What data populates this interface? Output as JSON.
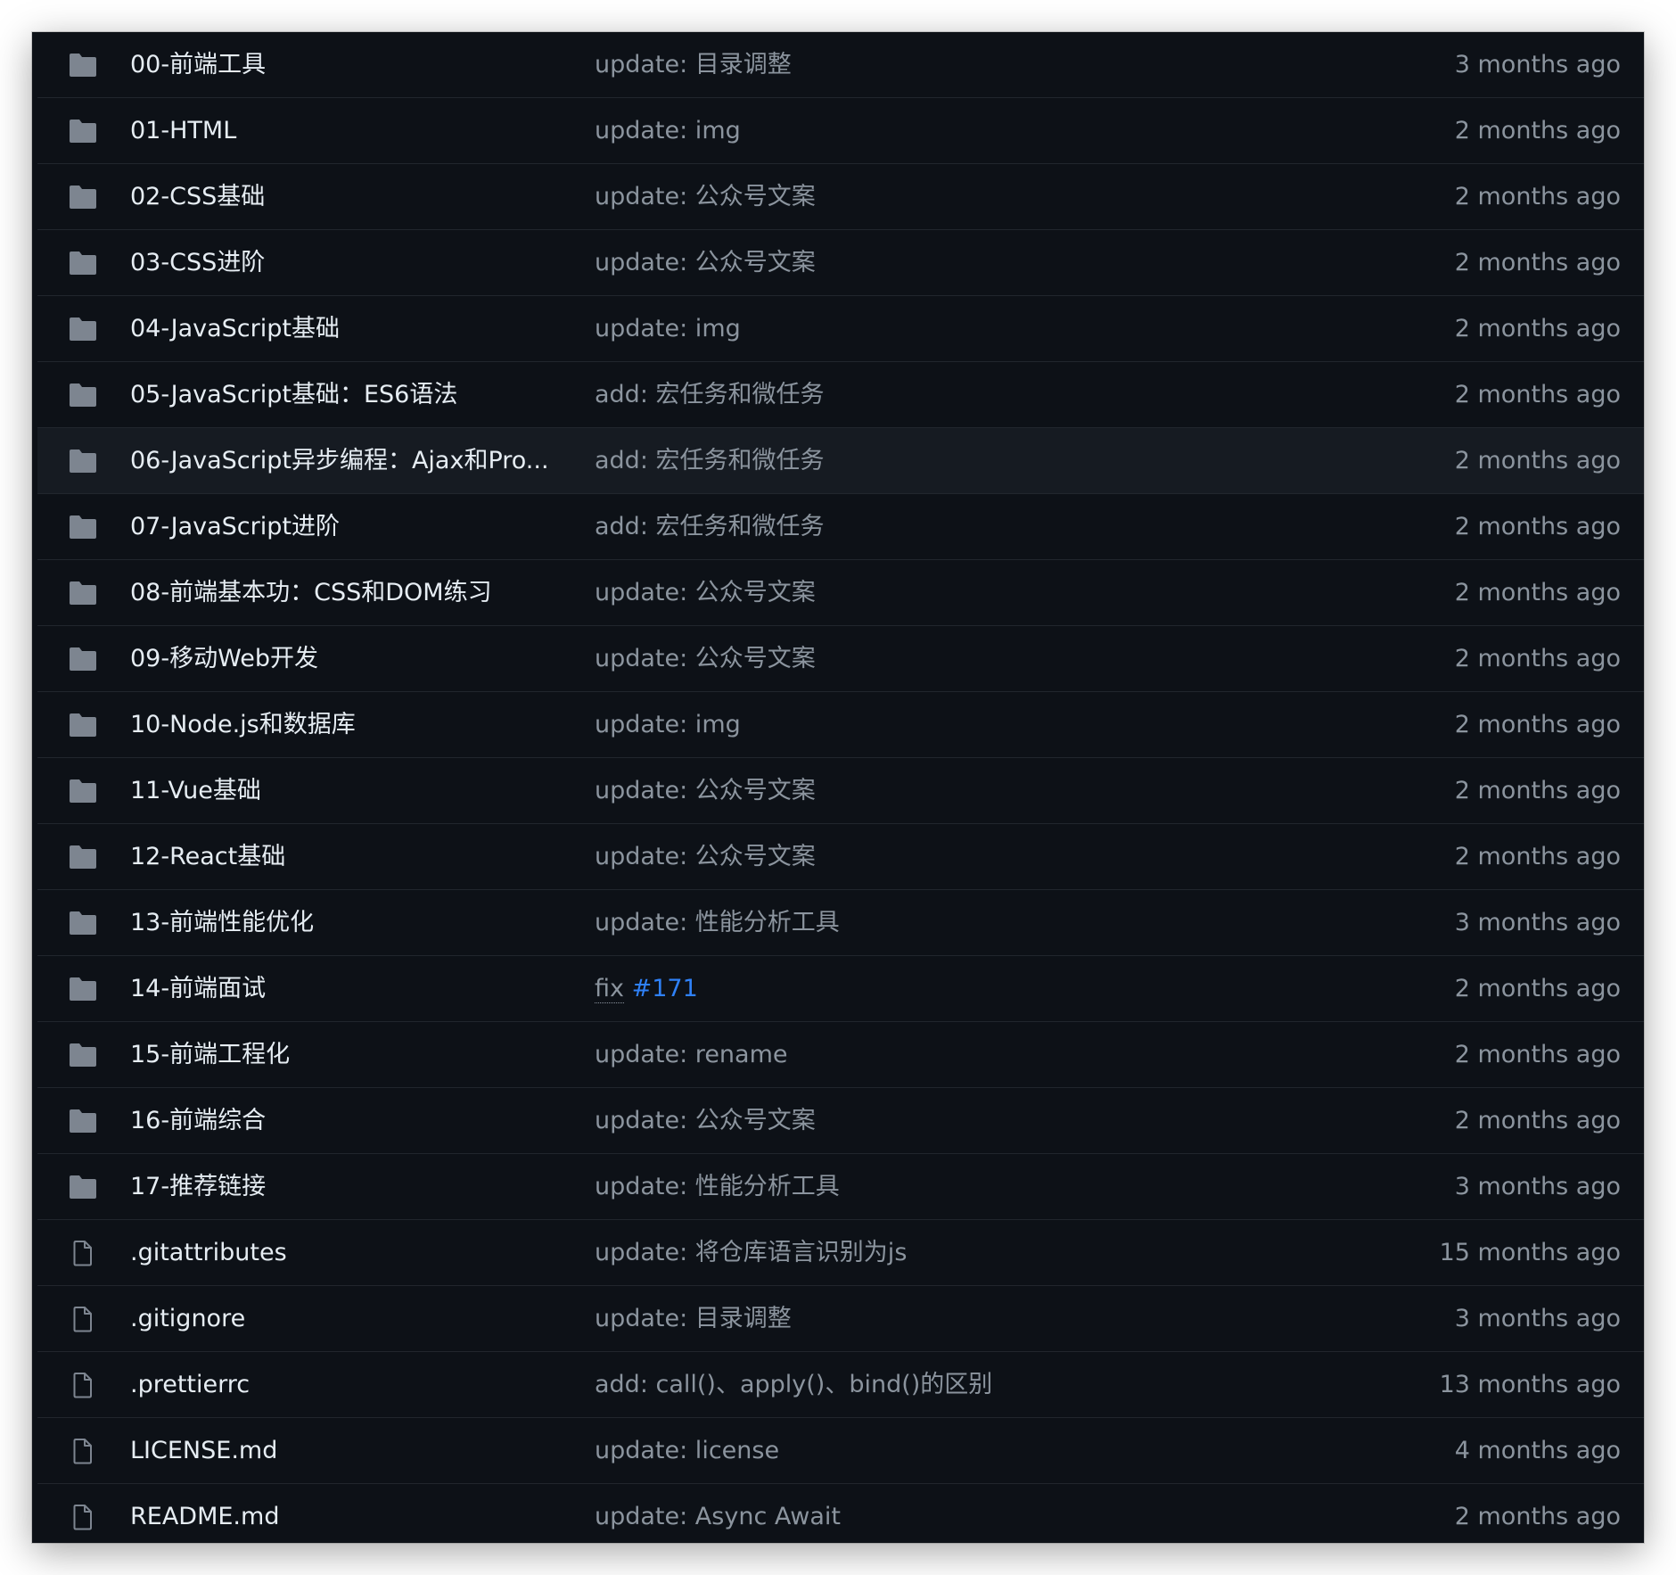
{
  "colors": {
    "background": "#0d1117",
    "row_border": "#21262d",
    "hover_row": "#161b22",
    "folder_icon": "#7d8590",
    "file_icon": "#7d8590",
    "name_text": "#e6edf3",
    "muted_text": "#8b949e",
    "link": "#2f81f7"
  },
  "rows": [
    {
      "type": "folder",
      "icon": "folder-icon",
      "name": "00-前端工具",
      "message": "update: 目录调整",
      "age": "3 months ago"
    },
    {
      "type": "folder",
      "icon": "folder-icon",
      "name": "01-HTML",
      "message": "update: img",
      "age": "2 months ago"
    },
    {
      "type": "folder",
      "icon": "folder-icon",
      "name": "02-CSS基础",
      "message": "update: 公众号文案",
      "age": "2 months ago"
    },
    {
      "type": "folder",
      "icon": "folder-icon",
      "name": "03-CSS进阶",
      "message": "update: 公众号文案",
      "age": "2 months ago"
    },
    {
      "type": "folder",
      "icon": "folder-icon",
      "name": "04-JavaScript基础",
      "message": "update: img",
      "age": "2 months ago"
    },
    {
      "type": "folder",
      "icon": "folder-icon",
      "name": "05-JavaScript基础：ES6语法",
      "message": "add: 宏任务和微任务",
      "age": "2 months ago"
    },
    {
      "type": "folder",
      "icon": "folder-icon",
      "name": "06-JavaScript异步编程：Ajax和Pro...",
      "message": "add: 宏任务和微任务",
      "age": "2 months ago",
      "hovered": true
    },
    {
      "type": "folder",
      "icon": "folder-icon",
      "name": "07-JavaScript进阶",
      "message": "add: 宏任务和微任务",
      "age": "2 months ago"
    },
    {
      "type": "folder",
      "icon": "folder-icon",
      "name": "08-前端基本功：CSS和DOM练习",
      "message": "update: 公众号文案",
      "age": "2 months ago"
    },
    {
      "type": "folder",
      "icon": "folder-icon",
      "name": "09-移动Web开发",
      "message": "update: 公众号文案",
      "age": "2 months ago"
    },
    {
      "type": "folder",
      "icon": "folder-icon",
      "name": "10-Node.js和数据库",
      "message": "update: img",
      "age": "2 months ago"
    },
    {
      "type": "folder",
      "icon": "folder-icon",
      "name": "11-Vue基础",
      "message": "update: 公众号文案",
      "age": "2 months ago"
    },
    {
      "type": "folder",
      "icon": "folder-icon",
      "name": "12-React基础",
      "message": "update: 公众号文案",
      "age": "2 months ago"
    },
    {
      "type": "folder",
      "icon": "folder-icon",
      "name": "13-前端性能优化",
      "message": "update: 性能分析工具",
      "age": "3 months ago"
    },
    {
      "type": "folder",
      "icon": "folder-icon",
      "name": "14-前端面试",
      "message": "fix",
      "message_link": "#171",
      "age": "2 months ago"
    },
    {
      "type": "folder",
      "icon": "folder-icon",
      "name": "15-前端工程化",
      "message": "update: rename",
      "age": "2 months ago"
    },
    {
      "type": "folder",
      "icon": "folder-icon",
      "name": "16-前端综合",
      "message": "update: 公众号文案",
      "age": "2 months ago"
    },
    {
      "type": "folder",
      "icon": "folder-icon",
      "name": "17-推荐链接",
      "message": "update: 性能分析工具",
      "age": "3 months ago"
    },
    {
      "type": "file",
      "icon": "file-icon",
      "name": ".gitattributes",
      "message": "update: 将仓库语言识别为js",
      "age": "15 months ago"
    },
    {
      "type": "file",
      "icon": "file-icon",
      "name": ".gitignore",
      "message": "update: 目录调整",
      "age": "3 months ago"
    },
    {
      "type": "file",
      "icon": "file-icon",
      "name": ".prettierrc",
      "message": "add: call()、apply()、bind()的区别",
      "age": "13 months ago"
    },
    {
      "type": "file",
      "icon": "file-icon",
      "name": "LICENSE.md",
      "message": "update: license",
      "age": "4 months ago"
    },
    {
      "type": "file",
      "icon": "file-icon",
      "name": "README.md",
      "message": "update: Async Await",
      "age": "2 months ago"
    }
  ]
}
